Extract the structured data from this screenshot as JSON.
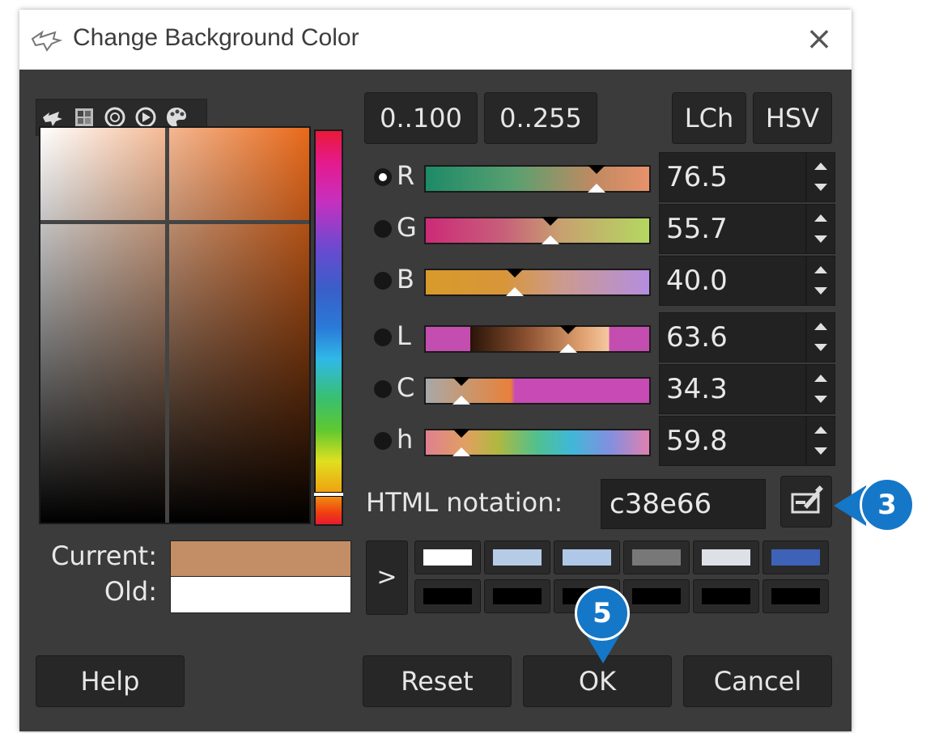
{
  "dialog": {
    "title": "Change Background Color",
    "close_glyph": "×"
  },
  "selector_tabs": [
    "gimp-icon",
    "cmyk-grid-icon",
    "color-wheel-icon",
    "triangle-icon",
    "palette-icon"
  ],
  "ranges": {
    "r100": "0..100",
    "r255": "0..255"
  },
  "models": {
    "lch": "LCh",
    "hsv": "HSV"
  },
  "channels": [
    {
      "label": "R",
      "value": "76.5",
      "selected": true
    },
    {
      "label": "G",
      "value": "55.7",
      "selected": false
    },
    {
      "label": "B",
      "value": "40.0",
      "selected": false
    },
    {
      "label": "L",
      "value": "63.6",
      "selected": false
    },
    {
      "label": "C",
      "value": "34.3",
      "selected": false
    },
    {
      "label": "h",
      "value": "59.8",
      "selected": false
    }
  ],
  "html_notation": {
    "label": "HTML notation:",
    "value": "c38e66"
  },
  "swatches": {
    "current_label": "Current:",
    "old_label": "Old:",
    "current_color": "#c38e66",
    "old_color": "#ffffff"
  },
  "history": {
    "expand_glyph": ">",
    "colors_top": [
      "#ffffff",
      "#b6cbe6",
      "#b0c8e8",
      "#787878",
      "#dde0e6",
      "#3d62b8"
    ],
    "colors_bottom": [
      "#000000",
      "#000000",
      "#000000",
      "#000000",
      "#000000",
      "#000000"
    ]
  },
  "buttons": {
    "help": "Help",
    "reset": "Reset",
    "ok": "OK",
    "cancel": "Cancel"
  },
  "callouts": {
    "three": "3",
    "five": "5",
    "color": "#1577c8"
  }
}
